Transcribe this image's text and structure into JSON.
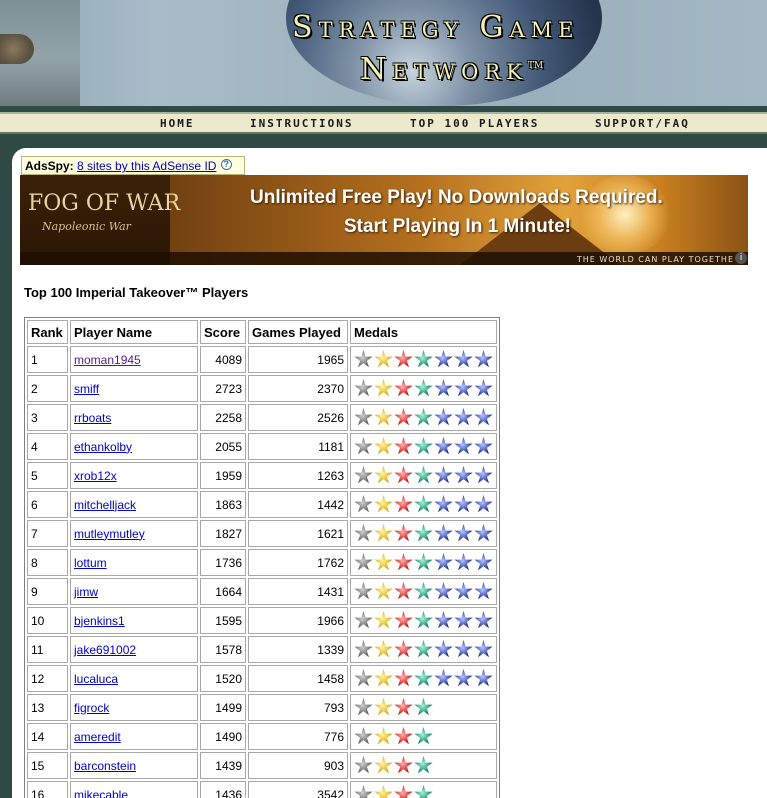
{
  "header": {
    "title_line1": "Strategy Game",
    "title_line2": "Network",
    "trademark": "TM"
  },
  "nav": [
    {
      "label": "Home"
    },
    {
      "label": "Instructions"
    },
    {
      "label": "Top 100 Players"
    },
    {
      "label": "Support/FAQ"
    }
  ],
  "adsspy": {
    "label": "AdsSpy:",
    "link": "8 sites by this AdSense ID",
    "help": "?"
  },
  "banner": {
    "logo_title": "FOG OF WAR",
    "logo_subtitle": "Napoleonic War",
    "line1": "Unlimited Free Play!  No Downloads Required.",
    "line2": "Start Playing In 1 Minute!",
    "tagline": "The world can play togethe",
    "info": "i"
  },
  "page_title": "Top 100 Imperial Takeover™ Players",
  "table": {
    "headers": {
      "rank": "Rank",
      "name": "Player Name",
      "score": "Score",
      "games": "Games Played",
      "medals": "Medals"
    },
    "medal_sets": {
      "seven": [
        "gray",
        "gold",
        "red",
        "green",
        "blue",
        "blue",
        "blue"
      ],
      "four": [
        "gray",
        "gold",
        "red",
        "green"
      ]
    },
    "rows": [
      {
        "rank": "1",
        "name": "moman1945",
        "score": "4089",
        "games": "1965",
        "medals": "seven",
        "visited": true
      },
      {
        "rank": "2",
        "name": "smiff",
        "score": "2723",
        "games": "2370",
        "medals": "seven"
      },
      {
        "rank": "3",
        "name": "rrboats",
        "score": "2258",
        "games": "2526",
        "medals": "seven"
      },
      {
        "rank": "4",
        "name": "ethankolby",
        "score": "2055",
        "games": "1181",
        "medals": "seven"
      },
      {
        "rank": "5",
        "name": "xrob12x",
        "score": "1959",
        "games": "1263",
        "medals": "seven"
      },
      {
        "rank": "6",
        "name": "mitchelljack",
        "score": "1863",
        "games": "1442",
        "medals": "seven"
      },
      {
        "rank": "7",
        "name": "mutleymutley",
        "score": "1827",
        "games": "1621",
        "medals": "seven"
      },
      {
        "rank": "8",
        "name": "lottum",
        "score": "1736",
        "games": "1762",
        "medals": "seven"
      },
      {
        "rank": "9",
        "name": "jimw",
        "score": "1664",
        "games": "1431",
        "medals": "seven"
      },
      {
        "rank": "10",
        "name": "bjenkins1",
        "score": "1595",
        "games": "1966",
        "medals": "seven"
      },
      {
        "rank": "11",
        "name": "jake691002",
        "score": "1578",
        "games": "1339",
        "medals": "seven"
      },
      {
        "rank": "12",
        "name": "lucaluca",
        "score": "1520",
        "games": "1458",
        "medals": "seven"
      },
      {
        "rank": "13",
        "name": "figrock",
        "score": "1499",
        "games": "793",
        "medals": "four"
      },
      {
        "rank": "14",
        "name": "ameredit",
        "score": "1490",
        "games": "776",
        "medals": "four"
      },
      {
        "rank": "15",
        "name": "barconstein",
        "score": "1439",
        "games": "903",
        "medals": "four"
      },
      {
        "rank": "16",
        "name": "mikecable",
        "score": "1436",
        "games": "3542",
        "medals": "four"
      }
    ]
  }
}
